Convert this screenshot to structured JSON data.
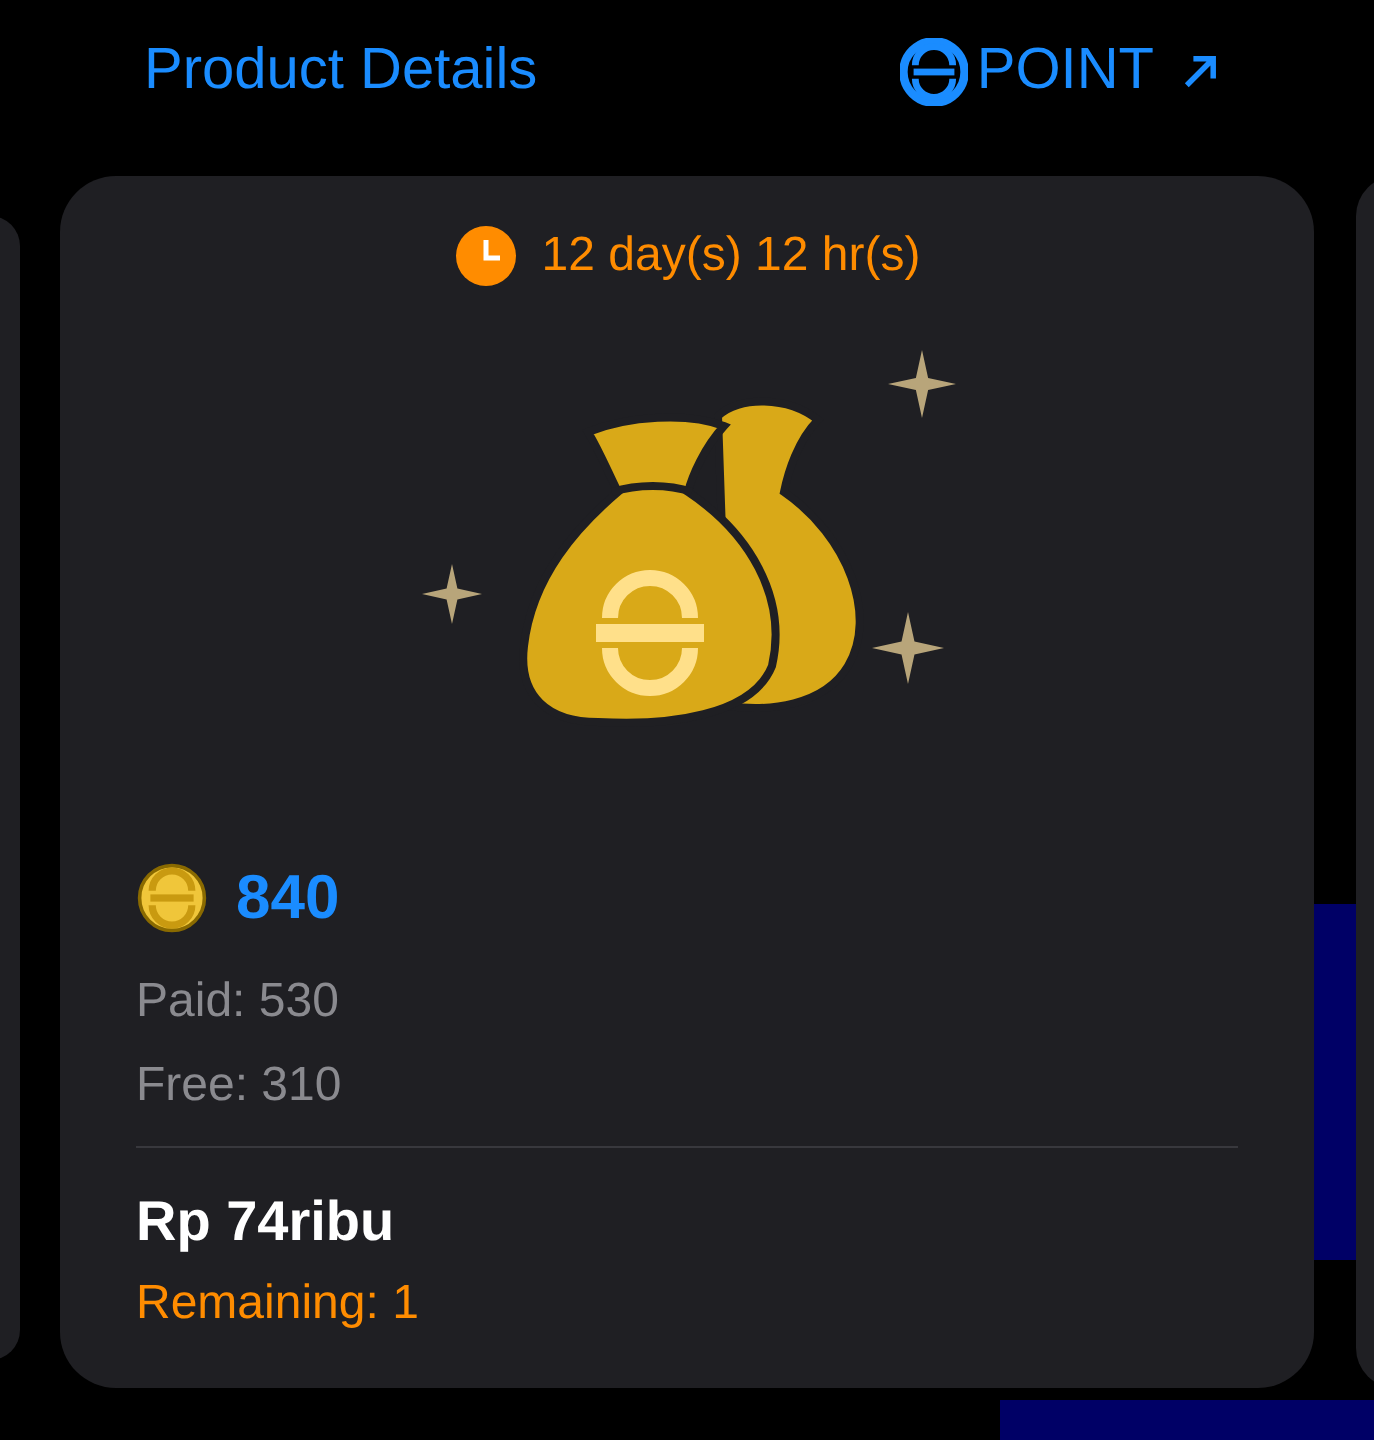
{
  "header": {
    "title": "Product Details",
    "link": "POINT"
  },
  "card": {
    "timer": "12 day(s) 12 hr(s)",
    "points": "840",
    "paid": "Paid: 530",
    "free": "Free: 310",
    "price": "Rp 74ribu",
    "remaining": "Remaining: 1"
  }
}
